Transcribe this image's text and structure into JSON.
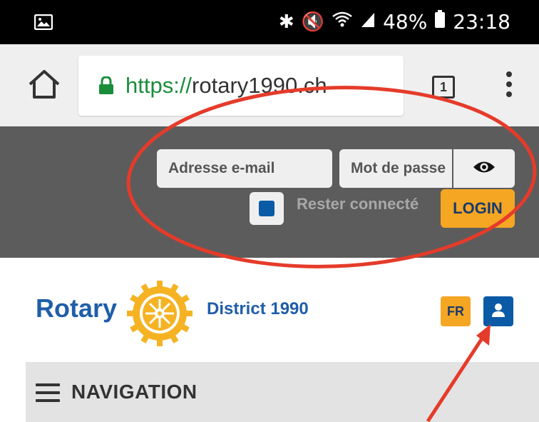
{
  "status_bar": {
    "battery": "48%",
    "time": "23:18",
    "icons": [
      "image-icon",
      "bluetooth-icon",
      "mute-icon",
      "wifi-icon",
      "signal-icon",
      "battery-icon"
    ]
  },
  "browser": {
    "url_scheme": "https://",
    "url_host": "rotary1990.ch",
    "tab_count": "1",
    "icons": [
      "home-icon",
      "lock-icon",
      "more-vert-icon"
    ]
  },
  "login": {
    "email_placeholder": "Adresse e-mail",
    "password_placeholder": "Mot de passe",
    "remember_label": "Rester connecté",
    "login_label": "LOGIN"
  },
  "header": {
    "logo_text": "Rotary",
    "district": "District 1990",
    "lang": "FR"
  },
  "nav": {
    "label": "NAVIGATION"
  },
  "colors": {
    "brand_blue": "#1f5ea8",
    "brand_gold": "#f5a623",
    "login_band": "#5c5c5c",
    "annotation_red": "#e53b2a"
  }
}
